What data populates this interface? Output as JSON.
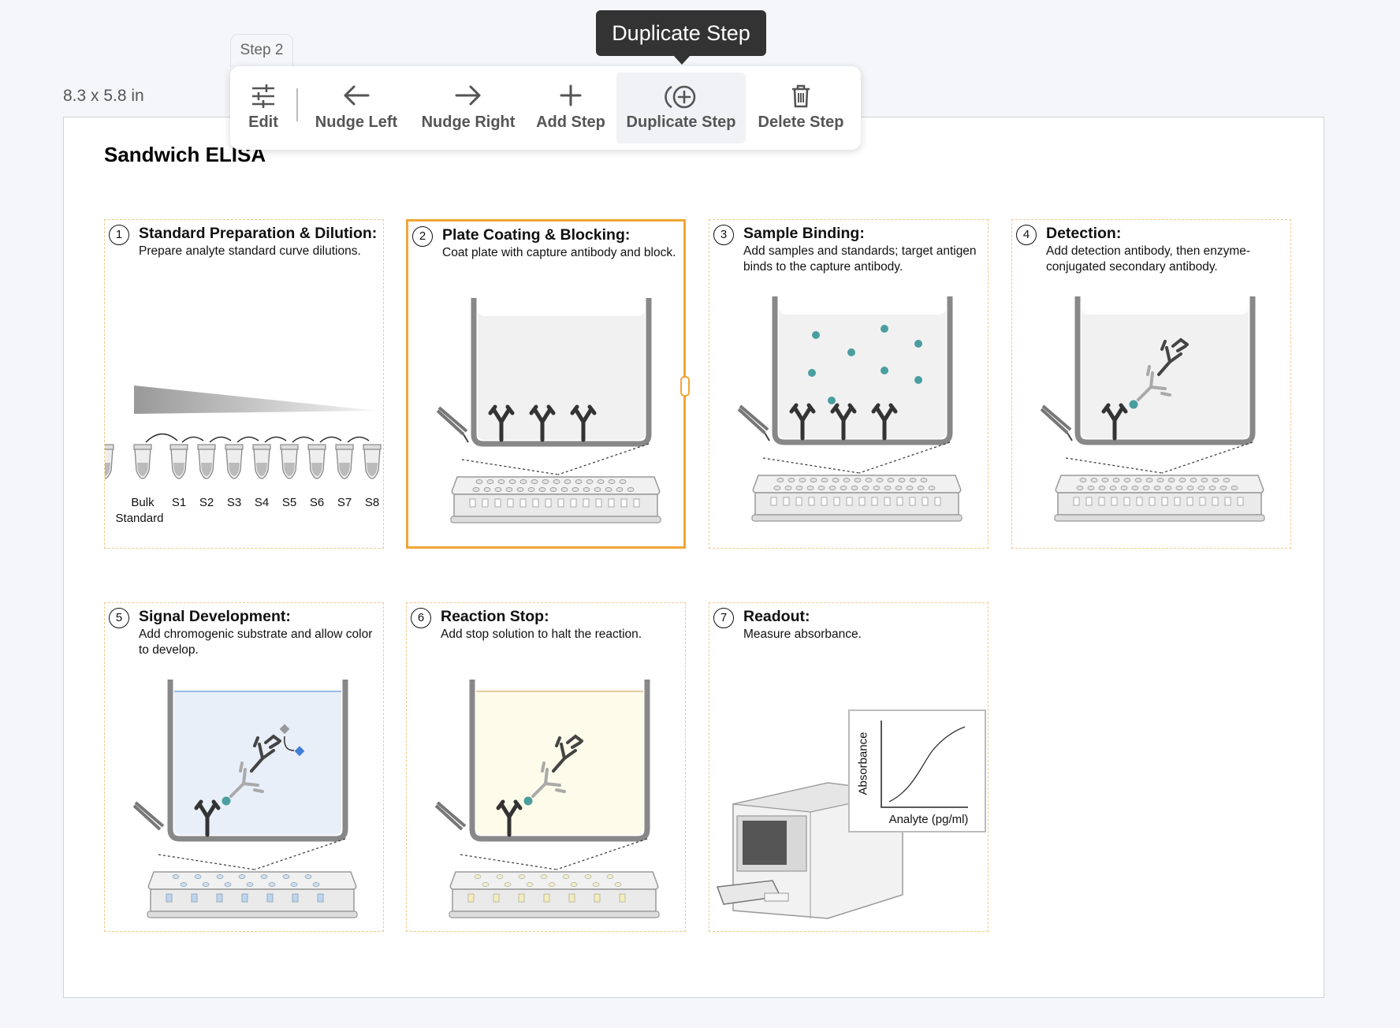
{
  "page": {
    "size_label": "8.3 x 5.8 in"
  },
  "toolbar": {
    "tab_label": "Step 2",
    "tooltip": "Duplicate Step",
    "buttons": [
      {
        "label": "Edit",
        "icon": "sliders-icon"
      },
      {
        "label": "Nudge Left",
        "icon": "arrow-left-icon"
      },
      {
        "label": "Nudge Right",
        "icon": "arrow-right-icon"
      },
      {
        "label": "Add Step",
        "icon": "plus-icon"
      },
      {
        "label": "Duplicate Step",
        "icon": "duplicate-circle-plus-icon",
        "active": true
      },
      {
        "label": "Delete Step",
        "icon": "trash-icon"
      }
    ]
  },
  "document": {
    "title": "Sandwich ELISA",
    "steps": [
      {
        "num": "1",
        "title": "Standard Preparation & Dilution:",
        "desc": "Prepare analyte standard curve dilutions.",
        "tubes": [
          "Bulk",
          "S1",
          "S2",
          "S3",
          "S4",
          "S5",
          "S6",
          "S7",
          "S8"
        ],
        "bulk_sub": "Standard"
      },
      {
        "num": "2",
        "title": "Plate Coating & Blocking:",
        "desc": "Coat plate with capture antibody and block.",
        "selected": true
      },
      {
        "num": "3",
        "title": "Sample Binding:",
        "desc": "Add samples and standards; target antigen binds to the capture antibody."
      },
      {
        "num": "4",
        "title": "Detection:",
        "desc": "Add detection antibody, then enzyme-conjugated secondary antibody."
      },
      {
        "num": "5",
        "title": "Signal Development:",
        "desc": "Add chromogenic substrate and allow color to develop."
      },
      {
        "num": "6",
        "title": "Reaction Stop:",
        "desc": "Add stop solution to halt the reaction."
      },
      {
        "num": "7",
        "title": "Readout:",
        "desc": "Measure absorbance.",
        "graph_ylabel": "Absorbance",
        "graph_xlabel": "Analyte (pg/ml)"
      }
    ]
  },
  "colors": {
    "selection": "#f0a637",
    "dashed_border": "#f2c98d",
    "antigen": "#4a9ea0",
    "substrate_fill": "#e8eff9",
    "stop_fill": "#fdfbe9",
    "enzyme_product": "#3f7fd6"
  }
}
